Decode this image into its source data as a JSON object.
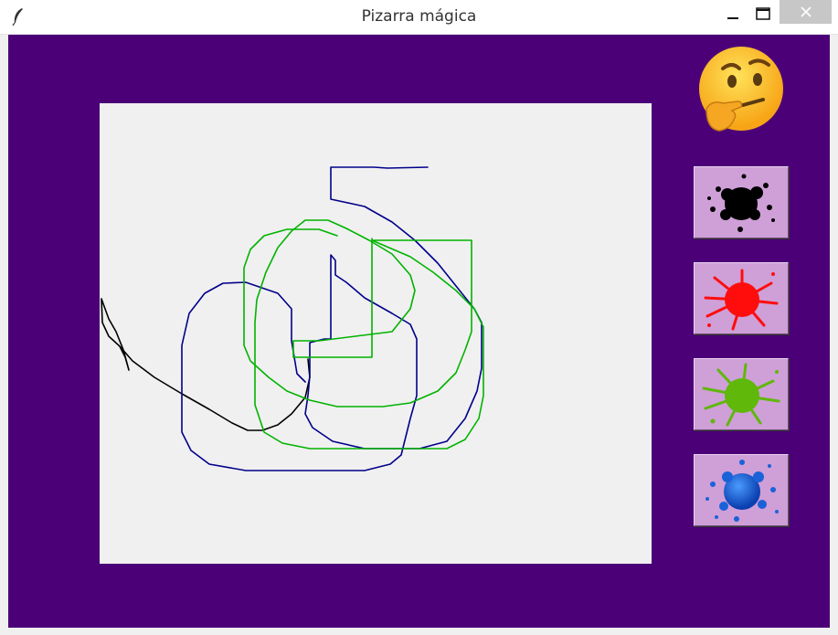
{
  "window": {
    "title": "Pizarra mágica",
    "controls": {
      "minimize": "─",
      "maximize": "☐",
      "close": "✕"
    }
  },
  "colors": {
    "background": "#4b0078",
    "canvas": "#f0f0f0",
    "button": "#cf9fd8",
    "stroke_black": "#000000",
    "stroke_blue": "#00008b",
    "stroke_green": "#00b300"
  },
  "emoji_icon": "thinking-face-emoji",
  "palette": [
    {
      "name": "black-splash",
      "color": "#000000"
    },
    {
      "name": "red-splash",
      "color": "#ff0d0d"
    },
    {
      "name": "green-splash",
      "color": "#5fb80a"
    },
    {
      "name": "blue-splash",
      "color": "#1a62d8"
    }
  ]
}
